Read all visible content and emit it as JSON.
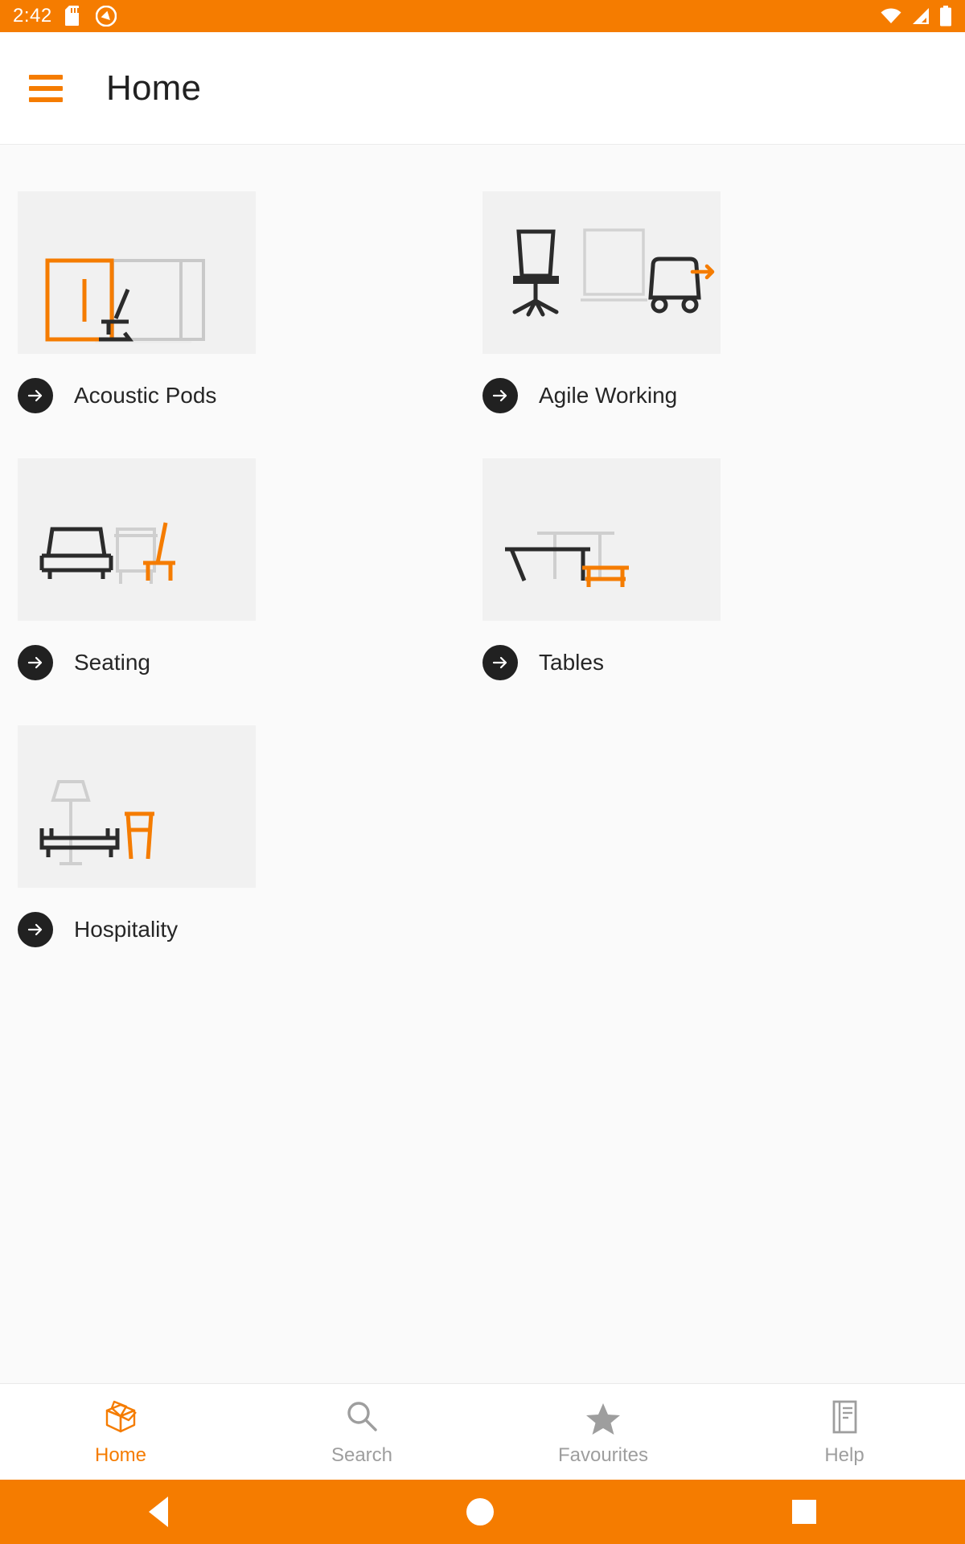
{
  "statusbar": {
    "time": "2:42",
    "icons": [
      "sd-card-icon",
      "do-not-disturb-icon",
      "wifi-icon",
      "cellular-signal-icon",
      "battery-icon"
    ],
    "background_color": "#F57C00"
  },
  "appbar": {
    "menu_icon": "hamburger-menu-icon",
    "title": "Home",
    "accent_color": "#F57C00",
    "title_color": "#212121"
  },
  "categories": [
    {
      "id": "acoustic-pods",
      "title": "Acoustic Pods",
      "illustration": "acoustic-pod-illustration"
    },
    {
      "id": "agile-working",
      "title": "Agile Working",
      "illustration": "agile-working-illustration"
    },
    {
      "id": "seating",
      "title": "Seating",
      "illustration": "seating-illustration"
    },
    {
      "id": "tables",
      "title": "Tables",
      "illustration": "tables-illustration"
    },
    {
      "id": "hospitality",
      "title": "Hospitality",
      "illustration": "hospitality-illustration"
    }
  ],
  "bottom_nav": {
    "items": [
      {
        "id": "home",
        "label": "Home",
        "icon": "open-box-icon",
        "active": true
      },
      {
        "id": "search",
        "label": "Search",
        "icon": "search-icon",
        "active": false
      },
      {
        "id": "favourites",
        "label": "Favourites",
        "icon": "star-icon",
        "active": false
      },
      {
        "id": "help",
        "label": "Help",
        "icon": "document-icon",
        "active": false
      }
    ],
    "active_color": "#F57C00",
    "inactive_color": "#9e9e9e"
  },
  "system_nav": {
    "background_color": "#F57C00",
    "buttons": [
      "back-button",
      "home-button",
      "recents-button"
    ]
  }
}
